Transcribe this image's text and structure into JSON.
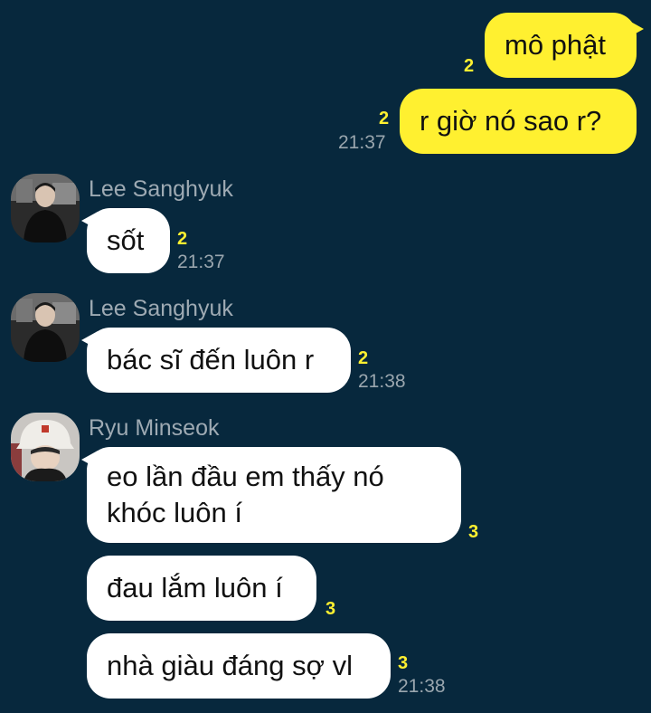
{
  "colors": {
    "background": "#07283d",
    "my_bubble": "#fff030",
    "their_bubble": "#ffffff",
    "unread_count": "#fff030",
    "meta_text": "#9aa6ae"
  },
  "messages": [
    {
      "sender": "me",
      "text": "mô phật",
      "unread": "2",
      "time": ""
    },
    {
      "sender": "me",
      "text": "r giờ nó sao r?",
      "unread": "2",
      "time": "21:37"
    },
    {
      "sender": "Lee Sanghyuk",
      "text": "sốt",
      "unread": "2",
      "time": "21:37"
    },
    {
      "sender": "Lee Sanghyuk",
      "text": "bác sĩ đến luôn r",
      "unread": "2",
      "time": "21:38"
    },
    {
      "sender": "Ryu Minseok",
      "lines": [
        "eo lần đầu em thấy nó",
        "khóc luôn í"
      ],
      "unread": "3",
      "time": ""
    },
    {
      "sender": "Ryu Minseok",
      "text": "đau lắm luôn í",
      "unread": "3",
      "time": ""
    },
    {
      "sender": "Ryu Minseok",
      "text": "nhà giàu đáng sợ vl",
      "unread": "3",
      "time": "21:38"
    }
  ],
  "avatars": {
    "lee": "person-avatar-icon",
    "ryu": "person-hat-avatar-icon"
  }
}
